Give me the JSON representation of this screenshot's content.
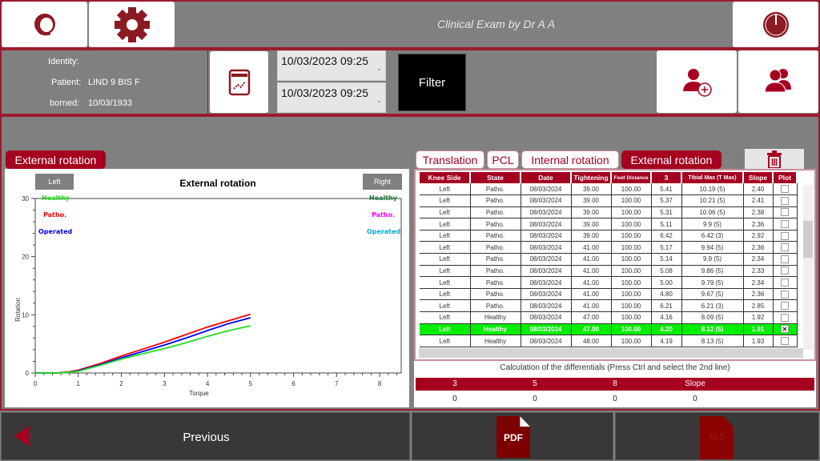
{
  "header": {
    "title": "Clinical Exam by Dr  A A",
    "support_icon": "headset-support-icon",
    "settings_icon": "gear-icon",
    "power_icon": "power-icon"
  },
  "patient": {
    "identity_label": "Identity:",
    "patient_label": "Patient:",
    "patient_value": "LIND 9 BIS  F",
    "borned_label": "borned:",
    "borned_value": "10/03/1933"
  },
  "filter": {
    "date_from": "10/03/2023 09:25",
    "date_to": "10/03/2023 09:25",
    "filter_label": "Filter",
    "report_icon": "chart-report-icon",
    "add_patient_icon": "add-user-icon",
    "patients_icon": "users-icon"
  },
  "chart_tab_label": "External rotation",
  "tabs": [
    {
      "label": "Translation",
      "active": false
    },
    {
      "label": "PCL",
      "active": false
    },
    {
      "label": "Internal rotation",
      "active": false
    },
    {
      "label": "External rotation",
      "active": true
    }
  ],
  "delete_icon": "trash-icon",
  "chart_data": {
    "type": "line",
    "title": "External rotation",
    "xlabel": "Torque",
    "ylabel": "Rotation",
    "xlim": [
      0,
      8.5
    ],
    "ylim": [
      0,
      30
    ],
    "xticks": [
      "0",
      "1",
      "2",
      "3",
      "4",
      "5",
      "6",
      "7",
      "8"
    ],
    "yticks": [
      "0",
      "10",
      "20",
      "30"
    ],
    "side_buttons": {
      "left": "Left",
      "right": "Right"
    },
    "legend_left": [
      {
        "label": "Healthy",
        "color": "#22dd22"
      },
      {
        "label": "Patho.",
        "color": "#ff0000"
      },
      {
        "label": "Operated",
        "color": "#0000ff"
      }
    ],
    "legend_right": [
      {
        "label": "Healthy",
        "color": "#1a7a3a"
      },
      {
        "label": "Patho.",
        "color": "#ff00ff"
      },
      {
        "label": "Operated",
        "color": "#00aadd"
      }
    ],
    "series": [
      {
        "name": "Patho.",
        "color": "#ff0000",
        "x": [
          0,
          0.5,
          0.8,
          1,
          1.5,
          2,
          2.5,
          3,
          3.5,
          4,
          4.5,
          5
        ],
        "y": [
          0,
          0,
          0.2,
          0.5,
          1.6,
          2.9,
          4.1,
          5.3,
          6.6,
          7.9,
          9,
          10.1
        ]
      },
      {
        "name": "Operated",
        "color": "#0000ff",
        "x": [
          0,
          0.5,
          0.8,
          1,
          1.5,
          2,
          2.5,
          3,
          3.5,
          4,
          4.5,
          5
        ],
        "y": [
          0,
          0,
          0.1,
          0.4,
          1.4,
          2.6,
          3.7,
          4.8,
          6.0,
          7.3,
          8.5,
          9.5
        ]
      },
      {
        "name": "Healthy",
        "color": "#22dd22",
        "x": [
          0,
          0.5,
          0.8,
          1,
          1.5,
          2,
          2.5,
          3,
          3.5,
          4,
          4.5,
          5
        ],
        "y": [
          0,
          0,
          0.1,
          0.3,
          1.3,
          2.4,
          3.3,
          4.2,
          5.2,
          6.3,
          7.3,
          8.1
        ]
      }
    ]
  },
  "table": {
    "columns": [
      "Knee Side",
      "State",
      "Date",
      "Tightening",
      "Foot Distance",
      "3",
      "Tibial Max (T Max)",
      "Slope",
      "Plot"
    ],
    "rows": [
      {
        "cells": [
          "Left",
          "Patho.",
          "08/03/2024",
          "39.00",
          "100.00",
          "5.41",
          "10.19 (5)",
          "2.40"
        ],
        "plot": false,
        "selected": false
      },
      {
        "cells": [
          "Left",
          "Patho.",
          "08/03/2024",
          "39.00",
          "100.00",
          "5.37",
          "10.21 (5)",
          "2.41"
        ],
        "plot": false,
        "selected": false
      },
      {
        "cells": [
          "Left",
          "Patho.",
          "08/03/2024",
          "39.00",
          "100.00",
          "5.31",
          "10.06 (5)",
          "2.38"
        ],
        "plot": false,
        "selected": false
      },
      {
        "cells": [
          "Left",
          "Patho.",
          "08/03/2024",
          "39.00",
          "100.00",
          "5.11",
          "9.9 (5)",
          "2.36"
        ],
        "plot": false,
        "selected": false
      },
      {
        "cells": [
          "Left",
          "Patho.",
          "08/03/2024",
          "39.00",
          "100.00",
          "6.42",
          "6.42 (3)",
          "2.92"
        ],
        "plot": false,
        "selected": false
      },
      {
        "cells": [
          "Left",
          "Patho.",
          "08/03/2024",
          "41.00",
          "100.00",
          "5.17",
          "9.94 (5)",
          "2.36"
        ],
        "plot": false,
        "selected": false
      },
      {
        "cells": [
          "Left",
          "Patho.",
          "08/03/2024",
          "41.00",
          "100.00",
          "5.14",
          "9.9 (5)",
          "2.34"
        ],
        "plot": false,
        "selected": false
      },
      {
        "cells": [
          "Left",
          "Patho.",
          "08/03/2024",
          "41.00",
          "100.00",
          "5.08",
          "9.86 (5)",
          "2.33"
        ],
        "plot": false,
        "selected": false
      },
      {
        "cells": [
          "Left",
          "Patho.",
          "08/03/2024",
          "41.00",
          "100.00",
          "5.00",
          "9.79 (5)",
          "2.34"
        ],
        "plot": false,
        "selected": false
      },
      {
        "cells": [
          "Left",
          "Patho.",
          "08/03/2024",
          "41.00",
          "100.00",
          "4.80",
          "9.67 (5)",
          "2.36"
        ],
        "plot": false,
        "selected": false
      },
      {
        "cells": [
          "Left",
          "Patho.",
          "08/03/2024",
          "41.00",
          "100.00",
          "6.21",
          "6.21 (3)",
          "2.85"
        ],
        "plot": false,
        "selected": false
      },
      {
        "cells": [
          "Left",
          "Healthy",
          "08/03/2024",
          "47.00",
          "100.00",
          "4.16",
          "8.09 (5)",
          "1.92"
        ],
        "plot": false,
        "selected": false
      },
      {
        "cells": [
          "Left",
          "Healthy",
          "08/03/2024",
          "47.00",
          "100.00",
          "4.20",
          "8.12 (5)",
          "1.91"
        ],
        "plot": true,
        "selected": true
      },
      {
        "cells": [
          "Left",
          "Healthy",
          "08/03/2024",
          "48.00",
          "100.00",
          "4.19",
          "8.13 (5)",
          "1.93"
        ],
        "plot": false,
        "selected": false
      }
    ]
  },
  "differentials": {
    "title": "Calculation of the differentials (Press Ctrl and select the 2nd line)",
    "headers": [
      "3",
      "5",
      "8",
      "Slope"
    ],
    "values": [
      "0",
      "0",
      "0",
      "0"
    ]
  },
  "footer": {
    "previous_label": "Previous",
    "pdf_label": "PDF",
    "xls_label": "XLS"
  },
  "colors": {
    "accent": "#a50020",
    "icon": "#8b1a22",
    "selected_row": "#00ee00"
  }
}
